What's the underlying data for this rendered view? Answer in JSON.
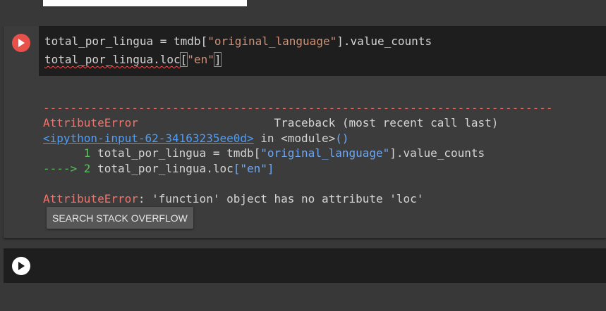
{
  "code_cell": {
    "line1": {
      "pre": "total_por_lingua = tmdb[",
      "str": "\"original_language\"",
      "post": "].value_counts"
    },
    "line2": {
      "squiggle": "total_por_lingua.loc",
      "bracket_open": "[",
      "str": "\"en\"",
      "bracket_close": "]"
    }
  },
  "output": {
    "dashes": "---------------------------------------------------------------------------",
    "error_name": "AttributeError",
    "traceback_label": "Traceback (most recent call last)",
    "input_link": "<ipython-input-62-34163235ee0d>",
    "in_module": " in ",
    "module": "<module>",
    "module_parens": "()",
    "tb_line1": {
      "num": "      1 ",
      "pre": "total_por_lingua = tmdb[",
      "str": "\"original_language\"",
      "post": "].value_counts"
    },
    "tb_line2": {
      "arrow": "----> 2 ",
      "pre": "total_por_lingua.loc",
      "bracket_open": "[",
      "str": "\"en\"",
      "bracket_close": "]"
    },
    "final_error_name": "AttributeError",
    "final_error_message": ": 'function' object has no attribute 'loc'",
    "search_button": "SEARCH STACK OVERFLOW"
  },
  "colors": {
    "run_button_active": "#e8514a",
    "error_red": "#f2736b",
    "string": "#ce9178",
    "link": "#4e9ef7"
  },
  "icons": {
    "run_active": "play-icon",
    "run_empty": "play-icon"
  }
}
